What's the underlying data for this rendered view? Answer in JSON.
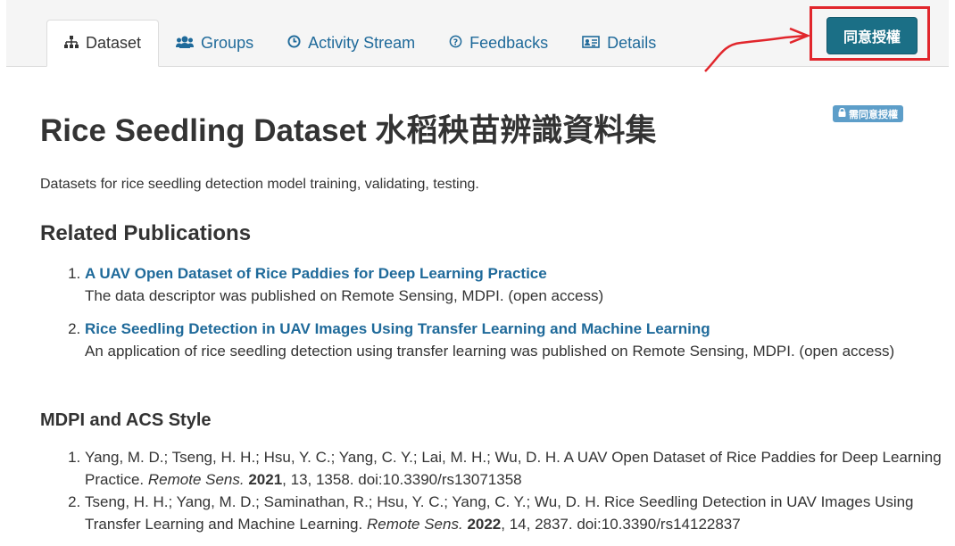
{
  "tabs": [
    {
      "label": "Dataset",
      "icon": "sitemap-icon",
      "active": true
    },
    {
      "label": "Groups",
      "icon": "users-icon",
      "active": false
    },
    {
      "label": "Activity Stream",
      "icon": "clock-icon",
      "active": false
    },
    {
      "label": "Feedbacks",
      "icon": "question-circle-icon",
      "active": false
    },
    {
      "label": "Details",
      "icon": "id-card-icon",
      "active": false
    }
  ],
  "grant_button": {
    "label": "同意授權"
  },
  "access_badge": {
    "label": "需同意授權",
    "icon": "lock-icon"
  },
  "title": "Rice Seedling Dataset 水稻秧苗辨識資料集",
  "description": "Datasets for rice seedling detection model training, validating, testing.",
  "related_publications": {
    "heading": "Related Publications",
    "items": [
      {
        "title": "A UAV Open Dataset of Rice Paddies for Deep Learning Practice",
        "note": "The data descriptor was published on Remote Sensing, MDPI. (open access)"
      },
      {
        "title": "Rice Seedling Detection in UAV Images Using Transfer Learning and Machine Learning",
        "note": "An application of rice seedling detection using transfer learning was published on Remote Sensing, MDPI. (open access)"
      }
    ]
  },
  "citation_style": {
    "heading": "MDPI and ACS Style",
    "items": [
      {
        "authors_title": "Yang, M. D.; Tseng, H. H.; Hsu, Y. C.; Yang, C. Y.; Lai, M. H.; Wu, D. H. A UAV Open Dataset of Rice Paddies for Deep Learning Practice.",
        "journal": "Remote Sens.",
        "year": "2021",
        "rest": ", 13, 1358. doi:10.3390/rs13071358"
      },
      {
        "authors_title": "Tseng, H. H.; Yang, M. D.; Saminathan, R.; Hsu, Y. C.; Yang, C. Y.; Wu, D. H. Rice Seedling Detection in UAV Images Using Transfer Learning and Machine Learning.",
        "journal": "Remote Sens.",
        "year": "2022",
        "rest": ", 14, 2837. doi:10.3390/rs14122837"
      }
    ]
  },
  "colors": {
    "accent": "#1b6f86",
    "link": "#1f6a9a",
    "highlight": "#e1262c",
    "badge": "#5d9ec9"
  }
}
